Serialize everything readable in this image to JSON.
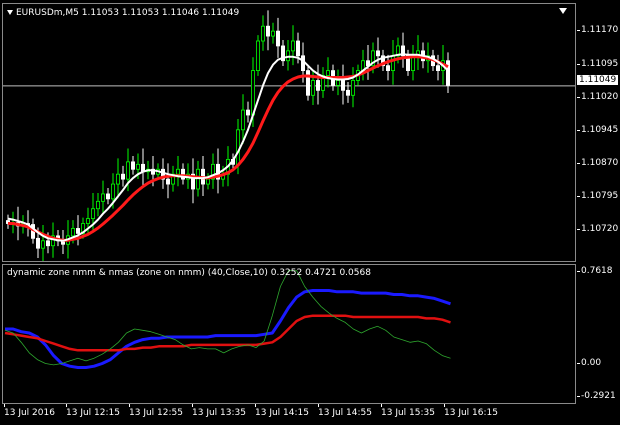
{
  "main": {
    "symbol_line": "EURUSDm,M5  1.11053 1.11053 1.11046 1.11049",
    "price_ticks": [
      "1.11170",
      "1.11095",
      "1.11020",
      "1.10945",
      "1.10870",
      "1.10795",
      "1.10720"
    ],
    "current_price": "1.11049",
    "colors": {
      "bull": "#00ff00",
      "bear": "#ffffff",
      "fast_ma": "#ffffff",
      "slow_ma": "#ff1a1a",
      "grid": "#c0c0c0"
    }
  },
  "indicator": {
    "info_line": "dynamic zone nmm & nmas (zone on nmm) (40,Close,10) 0.3252 0.4721 0.0568",
    "ticks": [
      "0.7618",
      "0.00",
      "-0.2921"
    ],
    "colors": {
      "blue": "#1a1aff",
      "red": "#e01010",
      "green": "#2ea82e"
    }
  },
  "time_axis": [
    "13 Jul 2016",
    "13 Jul 12:15",
    "13 Jul 12:55",
    "13 Jul 13:35",
    "13 Jul 14:15",
    "13 Jul 14:55",
    "13 Jul 15:35",
    "13 Jul 16:15"
  ],
  "chart_data": [
    {
      "type": "candlestick",
      "title": "EURUSDm,M5",
      "ylim": [
        1.1069,
        1.11215
      ],
      "close_series": [
        1.1077,
        1.10772,
        1.10765,
        1.1077,
        1.10768,
        1.1074,
        1.1072,
        1.10735,
        1.10725,
        1.10745,
        1.10735,
        1.10728,
        1.10745,
        1.1076,
        1.1075,
        1.1077,
        1.1078,
        1.108,
        1.10815,
        1.1083,
        1.1082,
        1.1085,
        1.1087,
        1.1086,
        1.10895,
        1.1088,
        1.1089,
        1.10875,
        1.1088,
        1.1087,
        1.1088,
        1.1086,
        1.1085,
        1.1087,
        1.1088,
        1.1086,
        1.1087,
        1.1084,
        1.1088,
        1.1085,
        1.1086,
        1.1089,
        1.1086,
        1.1087,
        1.109,
        1.1089,
        1.1096,
        1.11,
        1.1099,
        1.1108,
        1.1114,
        1.1117,
        1.1115,
        1.1116,
        1.1113,
        1.111,
        1.1112,
        1.1114,
        1.1111,
        1.1108,
        1.1103,
        1.1106,
        1.1104,
        1.1107,
        1.1108,
        1.1105,
        1.1106,
        1.1104,
        1.1103,
        1.1106,
        1.1108,
        1.111,
        1.1109,
        1.1112,
        1.1111,
        1.1109,
        1.1108,
        1.1111,
        1.1113,
        1.1111,
        1.1108,
        1.1111,
        1.1112,
        1.111,
        1.1111,
        1.1109,
        1.1108,
        1.111,
        1.1105
      ],
      "fast_ma": [
        1.1078,
        1.10778,
        1.10775,
        1.10772,
        1.10768,
        1.1076,
        1.10752,
        1.10745,
        1.1074,
        1.10738,
        1.10736,
        1.10735,
        1.10738,
        1.10742,
        1.10746,
        1.10752,
        1.1076,
        1.10768,
        1.10778,
        1.1079,
        1.108,
        1.10812,
        1.10825,
        1.10838,
        1.10852,
        1.10862,
        1.1087,
        1.10875,
        1.10878,
        1.10878,
        1.10876,
        1.10873,
        1.1087,
        1.10868,
        1.10866,
        1.10865,
        1.10864,
        1.10862,
        1.10862,
        1.10862,
        1.10864,
        1.10868,
        1.10872,
        1.10878,
        1.10886,
        1.10898,
        1.10915,
        1.10936,
        1.1096,
        1.1099,
        1.1102,
        1.1105,
        1.11075,
        1.11092,
        1.11102,
        1.11106,
        1.11108,
        1.11108,
        1.11106,
        1.111,
        1.1109,
        1.1108,
        1.11073,
        1.11068,
        1.11065,
        1.11063,
        1.11062,
        1.11062,
        1.11063,
        1.11066,
        1.11072,
        1.1108,
        1.11088,
        1.11096,
        1.11102,
        1.11106,
        1.11108,
        1.1111,
        1.11112,
        1.11113,
        1.11112,
        1.11112,
        1.11112,
        1.1111,
        1.11108,
        1.11104,
        1.11098,
        1.1109,
        1.1108
      ],
      "slow_ma": [
        1.1077,
        1.1077,
        1.10768,
        1.10766,
        1.10763,
        1.10758,
        1.10753,
        1.10748,
        1.10744,
        1.1074,
        1.10738,
        1.10736,
        1.10736,
        1.10738,
        1.1074,
        1.10744,
        1.10748,
        1.10754,
        1.10761,
        1.10769,
        1.10778,
        1.10787,
        1.10797,
        1.10807,
        1.10818,
        1.10828,
        1.10837,
        1.10845,
        1.10852,
        1.10857,
        1.10861,
        1.10864,
        1.10866,
        1.10867,
        1.10867,
        1.10867,
        1.10866,
        1.10865,
        1.10864,
        1.10863,
        1.10863,
        1.10864,
        1.10866,
        1.10869,
        1.10873,
        1.10879,
        1.10888,
        1.109,
        1.10915,
        1.10933,
        1.10955,
        1.10978,
        1.11,
        1.1102,
        1.11036,
        1.11048,
        1.11057,
        1.11063,
        1.11067,
        1.11069,
        1.11069,
        1.11068,
        1.11067,
        1.11066,
        1.11066,
        1.11066,
        1.11066,
        1.11066,
        1.11067,
        1.11068,
        1.11071,
        1.11075,
        1.1108,
        1.11085,
        1.1109,
        1.11094,
        1.11098,
        1.11101,
        1.11104,
        1.11106,
        1.11107,
        1.11108,
        1.11108,
        1.11107,
        1.11105,
        1.11102,
        1.11098,
        1.11093,
        1.11088
      ]
    },
    {
      "type": "line",
      "title": "dynamic zone nmm & nmas (zone on nmm)",
      "ylim": [
        -0.2921,
        0.7618
      ],
      "series": [
        {
          "values": [
            0.28,
            0.28,
            0.26,
            0.25,
            0.22,
            0.16,
            0.08,
            0.02,
            0.0,
            -0.01,
            -0.01,
            0.0,
            0.02,
            0.05,
            0.1,
            0.15,
            0.18,
            0.2,
            0.21,
            0.21,
            0.22,
            0.22,
            0.22,
            0.22,
            0.22,
            0.22,
            0.23,
            0.23,
            0.23,
            0.23,
            0.23,
            0.23,
            0.24,
            0.25,
            0.34,
            0.44,
            0.52,
            0.56,
            0.57,
            0.57,
            0.57,
            0.56,
            0.56,
            0.56,
            0.55,
            0.55,
            0.55,
            0.55,
            0.54,
            0.54,
            0.53,
            0.53,
            0.52,
            0.51,
            0.49,
            0.47
          ]
        },
        {
          "values": [
            0.25,
            0.24,
            0.23,
            0.22,
            0.21,
            0.19,
            0.17,
            0.15,
            0.13,
            0.12,
            0.12,
            0.12,
            0.12,
            0.12,
            0.12,
            0.13,
            0.13,
            0.14,
            0.14,
            0.15,
            0.15,
            0.15,
            0.15,
            0.16,
            0.16,
            0.16,
            0.16,
            0.16,
            0.16,
            0.16,
            0.16,
            0.16,
            0.17,
            0.18,
            0.22,
            0.28,
            0.34,
            0.37,
            0.38,
            0.38,
            0.38,
            0.38,
            0.38,
            0.37,
            0.37,
            0.37,
            0.37,
            0.37,
            0.37,
            0.37,
            0.37,
            0.37,
            0.36,
            0.36,
            0.35,
            0.33
          ]
        },
        {
          "values": [
            0.27,
            0.25,
            0.18,
            0.1,
            0.05,
            0.02,
            0.01,
            0.02,
            0.04,
            0.06,
            0.04,
            0.06,
            0.09,
            0.13,
            0.18,
            0.25,
            0.28,
            0.27,
            0.26,
            0.24,
            0.22,
            0.2,
            0.16,
            0.13,
            0.14,
            0.13,
            0.13,
            0.1,
            0.13,
            0.15,
            0.16,
            0.14,
            0.19,
            0.38,
            0.6,
            0.72,
            0.72,
            0.6,
            0.52,
            0.45,
            0.4,
            0.36,
            0.33,
            0.28,
            0.25,
            0.28,
            0.3,
            0.27,
            0.22,
            0.2,
            0.18,
            0.19,
            0.17,
            0.12,
            0.08,
            0.06
          ]
        }
      ]
    }
  ]
}
